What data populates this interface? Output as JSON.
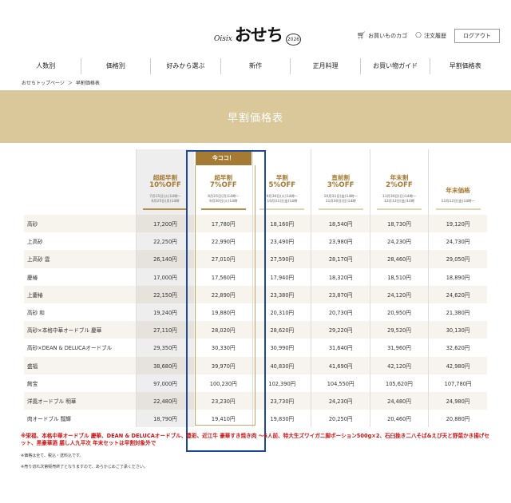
{
  "header": {
    "logo_oisix": "Oisix",
    "logo_osechi": "おせち",
    "logo_year": "2026",
    "cart_label": "お買いものカゴ",
    "history_label": "注文履歴",
    "login_label": "ログアウト"
  },
  "nav": [
    {
      "label": "人数別"
    },
    {
      "label": "価格別"
    },
    {
      "label": "好みから選ぶ"
    },
    {
      "label": "新作"
    },
    {
      "label": "正月料理"
    },
    {
      "label": "お買い物ガイド"
    },
    {
      "label": "早割価格表"
    }
  ],
  "breadcrumb": {
    "home": "おせちトップページ",
    "separator": "＞",
    "current": "早割価格表"
  },
  "banner": {
    "title": "早割価格表"
  },
  "table": {
    "badge": "今ココ！",
    "columns": [
      {
        "name": "超超早割",
        "discount": "10%OFF",
        "dates": [
          "7月15日(火)14時〜",
          "8月25日(月)14時"
        ]
      },
      {
        "name": "超早割",
        "discount": "7%OFF",
        "dates": [
          "8月25日(月)14時〜",
          "9月30日(火)14時"
        ]
      },
      {
        "name": "早割",
        "discount": "5%OFF",
        "dates": [
          "9月30日(火)14時〜",
          "10月31日(金)14時"
        ]
      },
      {
        "name": "直前割",
        "discount": "3%OFF",
        "dates": [
          "10月31日(金)14時〜",
          "11月30日(日)14時"
        ]
      },
      {
        "name": "年末割",
        "discount": "2%OFF",
        "dates": [
          "11月30日(日)14時〜",
          "12月12日(金)14時"
        ]
      },
      {
        "name": "年末価格",
        "discount": "",
        "dates": [
          "12月12日(金)14時〜"
        ]
      }
    ],
    "rows": [
      {
        "name": "高砂",
        "prices": [
          "17,200円",
          "17,780円",
          "18,160円",
          "18,540円",
          "18,730円",
          "19,120円"
        ]
      },
      {
        "name": "上高砂",
        "prices": [
          "22,250円",
          "22,990円",
          "23,490円",
          "23,980円",
          "24,230円",
          "24,730円"
        ]
      },
      {
        "name": "上高砂 雲",
        "prices": [
          "26,140円",
          "27,010円",
          "27,590円",
          "28,170円",
          "28,460円",
          "29,050円"
        ]
      },
      {
        "name": "慶椿",
        "prices": [
          "17,000円",
          "17,560円",
          "17,940円",
          "18,320円",
          "18,510円",
          "18,890円"
        ]
      },
      {
        "name": "上慶椿",
        "prices": [
          "22,150円",
          "22,890円",
          "23,380円",
          "23,870円",
          "24,120円",
          "24,620円"
        ]
      },
      {
        "name": "高砂 和",
        "prices": [
          "19,240円",
          "19,880円",
          "20,310円",
          "20,730円",
          "20,950円",
          "21,380円"
        ]
      },
      {
        "name": "高砂×本格中華オードブル 慶華",
        "prices": [
          "27,110円",
          "28,020円",
          "28,620円",
          "29,220円",
          "29,520円",
          "30,130円"
        ]
      },
      {
        "name": "高砂×DEAN & DELUCAオードブル",
        "prices": [
          "29,350円",
          "30,330円",
          "30,990円",
          "31,640円",
          "31,960円",
          "32,620円"
        ]
      },
      {
        "name": "盛福",
        "prices": [
          "38,680円",
          "39,970円",
          "40,830円",
          "41,690円",
          "42,120円",
          "42,980円"
        ]
      },
      {
        "name": "絢宝",
        "prices": [
          "97,000円",
          "100,230円",
          "102,390円",
          "104,550円",
          "105,620円",
          "107,780円"
        ]
      },
      {
        "name": "洋風オードブル 明華",
        "prices": [
          "22,480円",
          "23,230円",
          "23,730円",
          "24,230円",
          "24,480円",
          "24,980円"
        ]
      },
      {
        "name": "肉オードブル 瓢輝",
        "prices": [
          "18,790円",
          "19,410円",
          "19,830円",
          "20,250円",
          "20,460円",
          "20,880円"
        ]
      }
    ]
  },
  "notes": {
    "red": "※栄福、本格中華オードブル 慶華、DEAN & DELUCAオードブル、豊彩、近江牛 豪華すき焼き肉 〜6人前、特大生ズワイガニ脚ポーション500g×2、石臼挽き二八そば&えび天と野菜かき揚げセット、黒豪華酒 膳し人九平次 年末セットは早割対象外で",
    "tax": "※価格は全て、税込・送料込です。",
    "soldout": "※売り切れ次第販売終了となりますので、あらかじめご了承ください。"
  }
}
